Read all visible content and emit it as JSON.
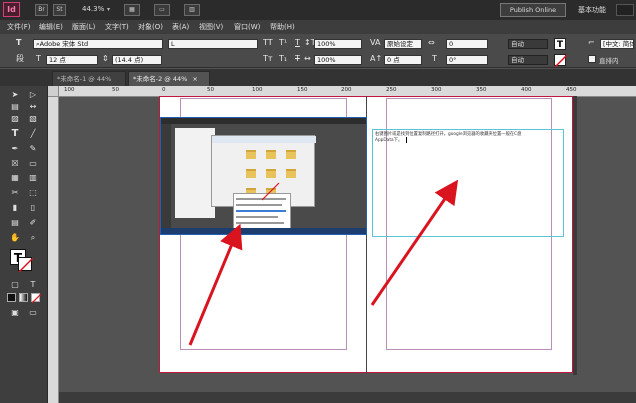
{
  "app": {
    "logo": "Id",
    "bridge": "Br",
    "stock": "St",
    "zoom": "44.3%",
    "publish_label": "Publish Online",
    "workspace_label": "基本功能"
  },
  "menus": [
    "文件(F)",
    "编辑(E)",
    "版面(L)",
    "文字(T)",
    "对象(O)",
    "表(A)",
    "视图(V)",
    "窗口(W)",
    "帮助(H)"
  ],
  "control": {
    "font_family": "Adobe 宋体 Std",
    "font_style": "L",
    "font_size": "12 点",
    "leading": "(14.4 点)",
    "vertical_scale": "100%",
    "horizontal_scale": "100%",
    "kerning": "原始设定",
    "tracking": "0",
    "baseline_shift": "0 点",
    "skew": "0°",
    "char_style": "自动",
    "lang": "自动",
    "language": "[中文: 简体]",
    "direction_label": "直排内",
    "icon_T": "T",
    "icon_T_sub": "T",
    "icon_para": "段"
  },
  "tabs": [
    {
      "label": "*未命名-1 @ 44%",
      "close": "×"
    },
    {
      "label": "*未命名-2 @ 44%",
      "close": "×"
    }
  ],
  "ruler": {
    "ticks": [
      "100",
      "50",
      "0",
      "50",
      "100",
      "150",
      "200",
      "250",
      "300",
      "350",
      "400",
      "450"
    ]
  },
  "frame_text": {
    "line1": "右键图片或是找到位置复制路径打开。google浏览器的收藏夹位置一般在C盘",
    "line2": "AppData下。"
  },
  "colors": {
    "accent": "#d23f79",
    "arrow": "#d9141f",
    "frame": "#5cc2d6"
  }
}
